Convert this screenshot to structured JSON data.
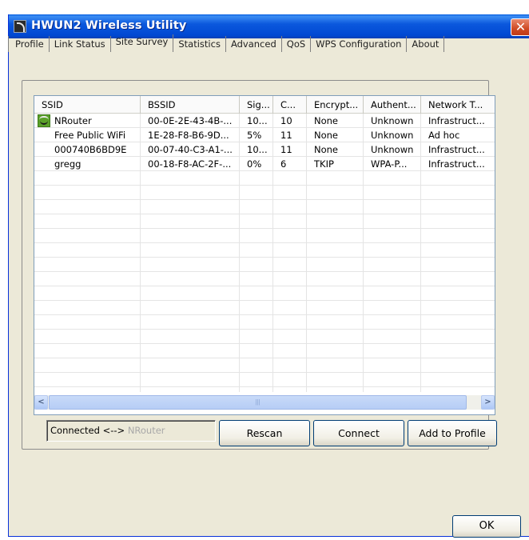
{
  "window": {
    "title": "HWUN2 Wireless Utility",
    "close_glyph": "✕"
  },
  "tabs": [
    {
      "label": "Profile"
    },
    {
      "label": "Link Status"
    },
    {
      "label": "Site Survey"
    },
    {
      "label": "Statistics"
    },
    {
      "label": "Advanced"
    },
    {
      "label": "QoS"
    },
    {
      "label": "WPS Configuration"
    },
    {
      "label": "About"
    }
  ],
  "active_tab": "Site Survey",
  "site_survey": {
    "columns": [
      "SSID",
      "BSSID",
      "Sig...",
      "C...",
      "Encrypt...",
      "Authent...",
      "Network T..."
    ],
    "rows": [
      {
        "ssid": "NRouter",
        "bssid": "00-0E-2E-43-4B-...",
        "signal": "10...",
        "channel": "10",
        "encryption": "None",
        "auth": "Unknown",
        "network_type": "Infrastruct...",
        "connected": true
      },
      {
        "ssid": "Free Public WiFi",
        "bssid": "1E-28-F8-B6-9D...",
        "signal": "5%",
        "channel": "11",
        "encryption": "None",
        "auth": "Unknown",
        "network_type": "Ad hoc",
        "connected": false
      },
      {
        "ssid": "000740B6BD9E",
        "bssid": "00-07-40-C3-A1-...",
        "signal": "10...",
        "channel": "11",
        "encryption": "None",
        "auth": "Unknown",
        "network_type": "Infrastruct...",
        "connected": false
      },
      {
        "ssid": "gregg",
        "bssid": "00-18-F8-AC-2F-...",
        "signal": "0%",
        "channel": "6",
        "encryption": "TKIP",
        "auth": "WPA-P...",
        "network_type": "Infrastruct...",
        "connected": false
      }
    ],
    "status": {
      "prefix": "Connected <-->",
      "ssid": "NRouter"
    },
    "buttons": {
      "rescan": "Rescan",
      "connect": "Connect",
      "add_to_profile": "Add to Profile"
    },
    "scrollbar": {
      "left": "<",
      "right": ">",
      "thumb_grip": "|||"
    }
  },
  "footer": {
    "ok": "OK"
  },
  "icons": {
    "connected": "connected-network-icon",
    "app": "wireless-app-icon"
  },
  "colors": {
    "titlebar": "#0b58dd",
    "close_button": "#cf4a23",
    "dialog_bg": "#ece9d8",
    "listview_border": "#7f9db9"
  }
}
